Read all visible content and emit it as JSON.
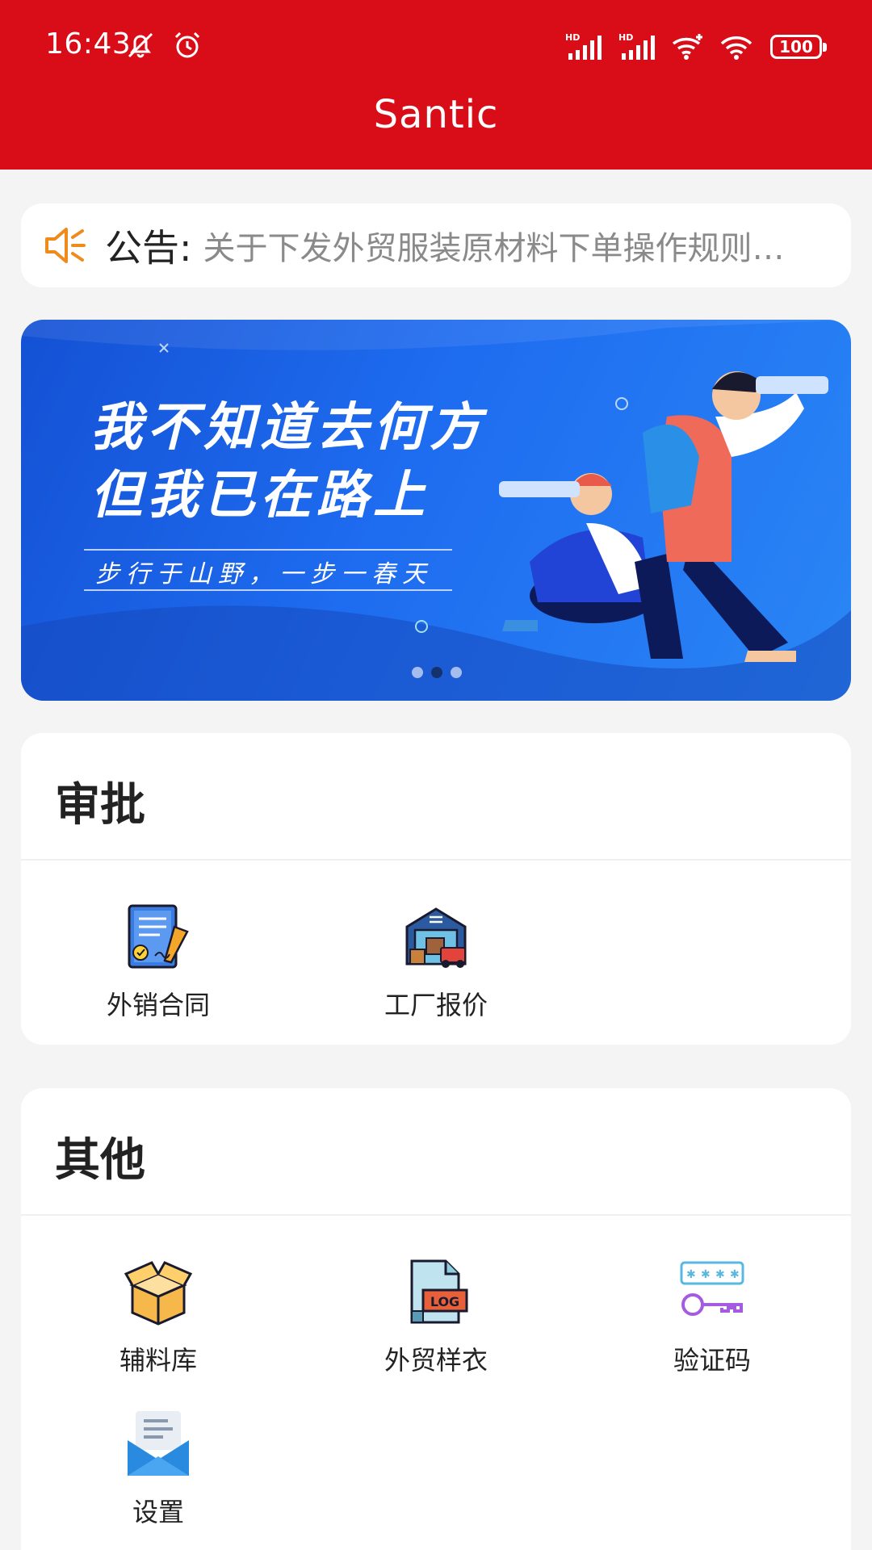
{
  "status_bar": {
    "time": "16:43",
    "battery": "100",
    "network_1": "HD",
    "network_2": "HD"
  },
  "header": {
    "title": "Santic"
  },
  "notice": {
    "label": "公告:",
    "text": "关于下发外贸服装原材料下单操作规则…"
  },
  "banner": {
    "headline_1": "我不知道去何方",
    "headline_2": "但我已在路上",
    "subline": "步行于山野，一步一春天",
    "page_count": 3,
    "active_page": 1
  },
  "sections": {
    "approve": {
      "title": "审批",
      "items": [
        {
          "label": "外销合同",
          "icon": "contract-icon"
        },
        {
          "label": "工厂报价",
          "icon": "factory-icon"
        }
      ]
    },
    "other": {
      "title": "其他",
      "items": [
        {
          "label": "辅料库",
          "icon": "box-icon"
        },
        {
          "label": "外贸样衣",
          "icon": "log-file-icon"
        },
        {
          "label": "验证码",
          "icon": "key-icon"
        },
        {
          "label": "设置",
          "icon": "mail-icon"
        }
      ]
    }
  },
  "colors": {
    "brand": "#d80d18",
    "accent_orange": "#f08a1c"
  }
}
